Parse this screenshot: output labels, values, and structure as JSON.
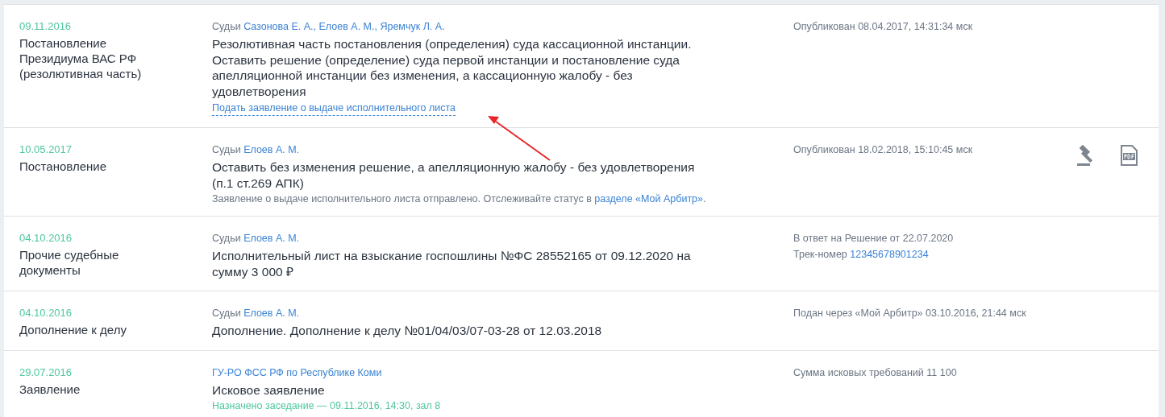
{
  "rows": [
    {
      "date": "09.11.2016",
      "type": "Постановление Президиума ВАС РФ (резолютивная часть)",
      "judges_label": "Судьи",
      "judges": [
        "Сазонова Е. А.,",
        "Елоев А. М.,",
        "Яремчук Л. А."
      ],
      "text": "Резолютивная часть постановления (определения) суда кассационной инстанции.\nОставить решение (определение) суда первой инстанции и постановление суда апелляционной инстанции без изменения, а кассационную жалобу - без удовлетворения",
      "extras": [
        {
          "kind": "action_link",
          "text": "Подать заявление о выдаче исполнительного листа"
        }
      ],
      "meta": [
        {
          "text": "Опубликован 08.04.2017, 14:31:34 мск"
        }
      ]
    },
    {
      "date": "10.05.2017",
      "type": "Постановление",
      "judges_label": "Судьи",
      "judges": [
        "Елоев А. М."
      ],
      "text": "Оставить без изменения решение, а апелляционную жалобу - без удовлетворения (п.1 ст.269 АПК)",
      "extras": [
        {
          "kind": "note",
          "text": "Заявление о выдаче исполнительного листа отправлено. Отслеживайте статус в ",
          "link": "разделе «Мой Арбитр»",
          "after": "."
        }
      ],
      "meta": [
        {
          "text": "Опубликован 18.02.2018, 15:10:45 мск"
        }
      ],
      "actions": [
        {
          "kind": "gavel"
        },
        {
          "kind": "pdf"
        }
      ]
    },
    {
      "date": "04.10.2016",
      "type": "Прочие судебные документы",
      "judges_label": "Судьи",
      "judges": [
        "Елоев А. М."
      ],
      "text": "Исполнительный лист на взыскание госпошлины №ФС 28552165 от 09.12.2020 на сумму 3 000 ₽",
      "meta": [
        {
          "text": "В ответ на Решение от 22.07.2020"
        },
        {
          "text": "Трек-номер ",
          "link": "12345678901234"
        }
      ]
    },
    {
      "date": "04.10.2016",
      "type": "Дополнение к делу",
      "judges_label": "Судьи",
      "judges": [
        "Елоев А. М."
      ],
      "text": "Дополнение. Дополнение к делу №01/04/03/07-03-28 от 12.03.2018",
      "meta": [
        {
          "text": "Подан через «Мой Арбитр» 03.10.2016, 21:44 мск"
        }
      ]
    },
    {
      "date": "29.07.2016",
      "type": "Заявление",
      "author": "ГУ-РО ФСС РФ по Республике Коми",
      "text": "Исковое заявление",
      "extras": [
        {
          "kind": "status",
          "text": "Назначено заседание — 09.11.2016, 14:30, зал 8"
        }
      ],
      "meta": [
        {
          "text": "Сумма исковых требований 11 100"
        }
      ]
    }
  ]
}
